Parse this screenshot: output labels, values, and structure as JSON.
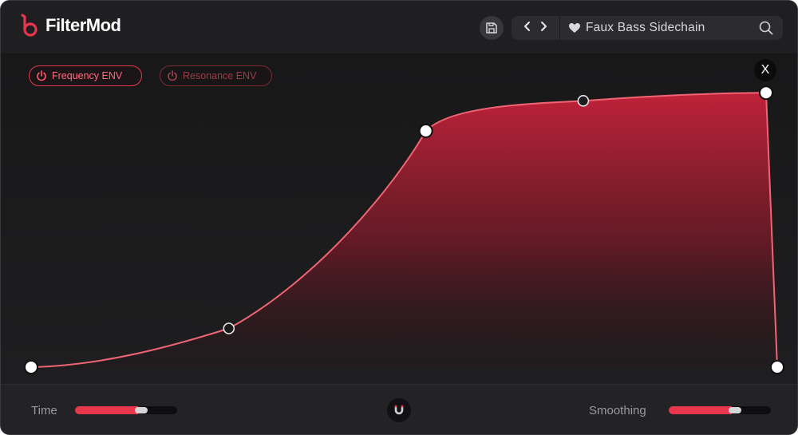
{
  "app": {
    "title": "FilterMod"
  },
  "header": {
    "preset_name": "Faux Bass Sidechain",
    "icons": {
      "save": "save-icon",
      "prev": "chevron-left-icon",
      "next": "chevron-right-icon",
      "favorite": "heart-icon",
      "search": "search-icon"
    }
  },
  "envelope": {
    "frequency_label": "Frequency ENV",
    "resonance_label": "Resonance ENV",
    "frequency_active": true,
    "resonance_active": false,
    "close_label": "X",
    "accent": "#e8374d",
    "points": [
      {
        "t": 0.0,
        "v": 0.0,
        "kind": "node"
      },
      {
        "t": 0.265,
        "v": 0.139,
        "kind": "handle"
      },
      {
        "t": 0.529,
        "v": 0.848,
        "kind": "node"
      },
      {
        "t": 0.74,
        "v": 0.956,
        "kind": "handle"
      },
      {
        "t": 0.985,
        "v": 0.985,
        "kind": "node"
      },
      {
        "t": 1.0,
        "v": 0.0,
        "kind": "node"
      }
    ]
  },
  "footer": {
    "time_label": "Time",
    "time_value": 0.62,
    "smoothing_label": "Smoothing",
    "smoothing_value": 0.62,
    "snap_icon": "magnet-icon"
  }
}
